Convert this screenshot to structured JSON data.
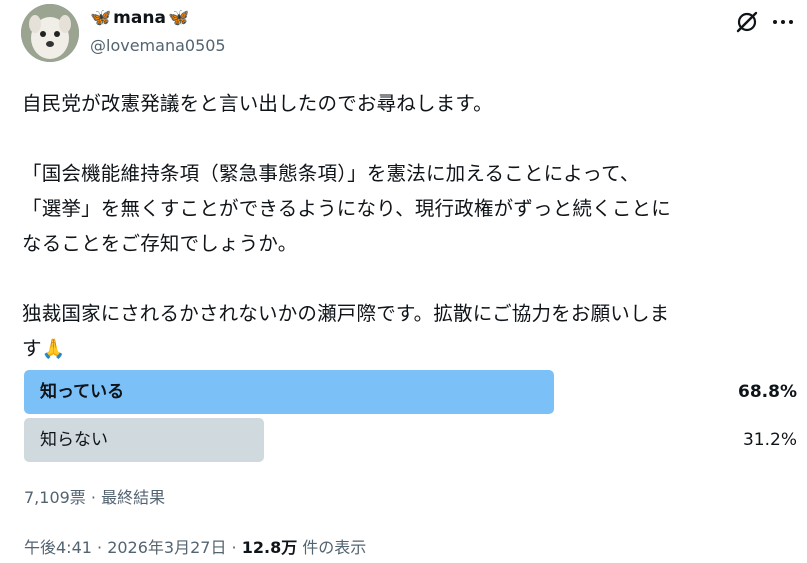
{
  "author": {
    "display_name": "mana",
    "name_decoration": "🦋",
    "handle": "@lovemana0505"
  },
  "icons": {
    "grok": "grok-icon",
    "more": "more-options-icon"
  },
  "tweet": {
    "text": "自民党が改憲発議をと言い出したのでお尋ねします。\n\n「国会機能維持条項（緊急事態条項）」を憲法に加えることによって、\n「選挙」を無くすことができるようになり、現行政権がずっと続くことに\nなることをご存知でしょうか。\n\n独裁国家にされるかされないかの瀬戸際です。拡散にご協力をお願いしま\nす",
    "emoji": "🙏"
  },
  "poll": {
    "options": [
      {
        "label": "知っている",
        "percent_text": "68.8%",
        "percent": 68.8,
        "color": "#7cc0f8",
        "winner": true
      },
      {
        "label": "知らない",
        "percent_text": "31.2%",
        "percent": 31.2,
        "color": "#cfd9de",
        "winner": false
      }
    ],
    "summary": "7,109票 · 最終結果"
  },
  "meta": {
    "time_date": "午後4:41 · 2026年3月27日 · ",
    "views_count": "12.8万",
    "views_label": " 件の表示"
  }
}
